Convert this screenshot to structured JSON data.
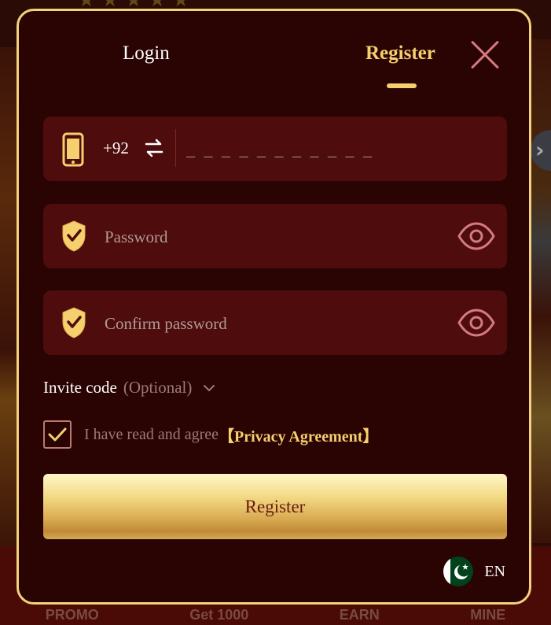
{
  "tabs": {
    "login": "Login",
    "register": "Register"
  },
  "phone": {
    "country_code": "+92",
    "placeholder": "_ _ _ _ _ _ _ _ _ _ _",
    "value": ""
  },
  "password": {
    "placeholder": "Password"
  },
  "confirm_password": {
    "placeholder": "Confirm password"
  },
  "invite": {
    "label": "Invite code",
    "optional": "(Optional)"
  },
  "agreement": {
    "checked": true,
    "text": "I have read and agree",
    "link": "【Privacy Agreement】"
  },
  "submit": {
    "label": "Register"
  },
  "language": {
    "label": "EN",
    "flag": "pakistan-flag-icon"
  },
  "background_nav": [
    "PROMO",
    "Get 1000",
    "EARN",
    "MINE"
  ],
  "colors": {
    "modal_bg": "#2a0403",
    "modal_border": "#f2d27a",
    "field_bg": "#4e0c0c",
    "accent_gold": "#f6cf6e",
    "icon_pink": "#d47a80"
  }
}
